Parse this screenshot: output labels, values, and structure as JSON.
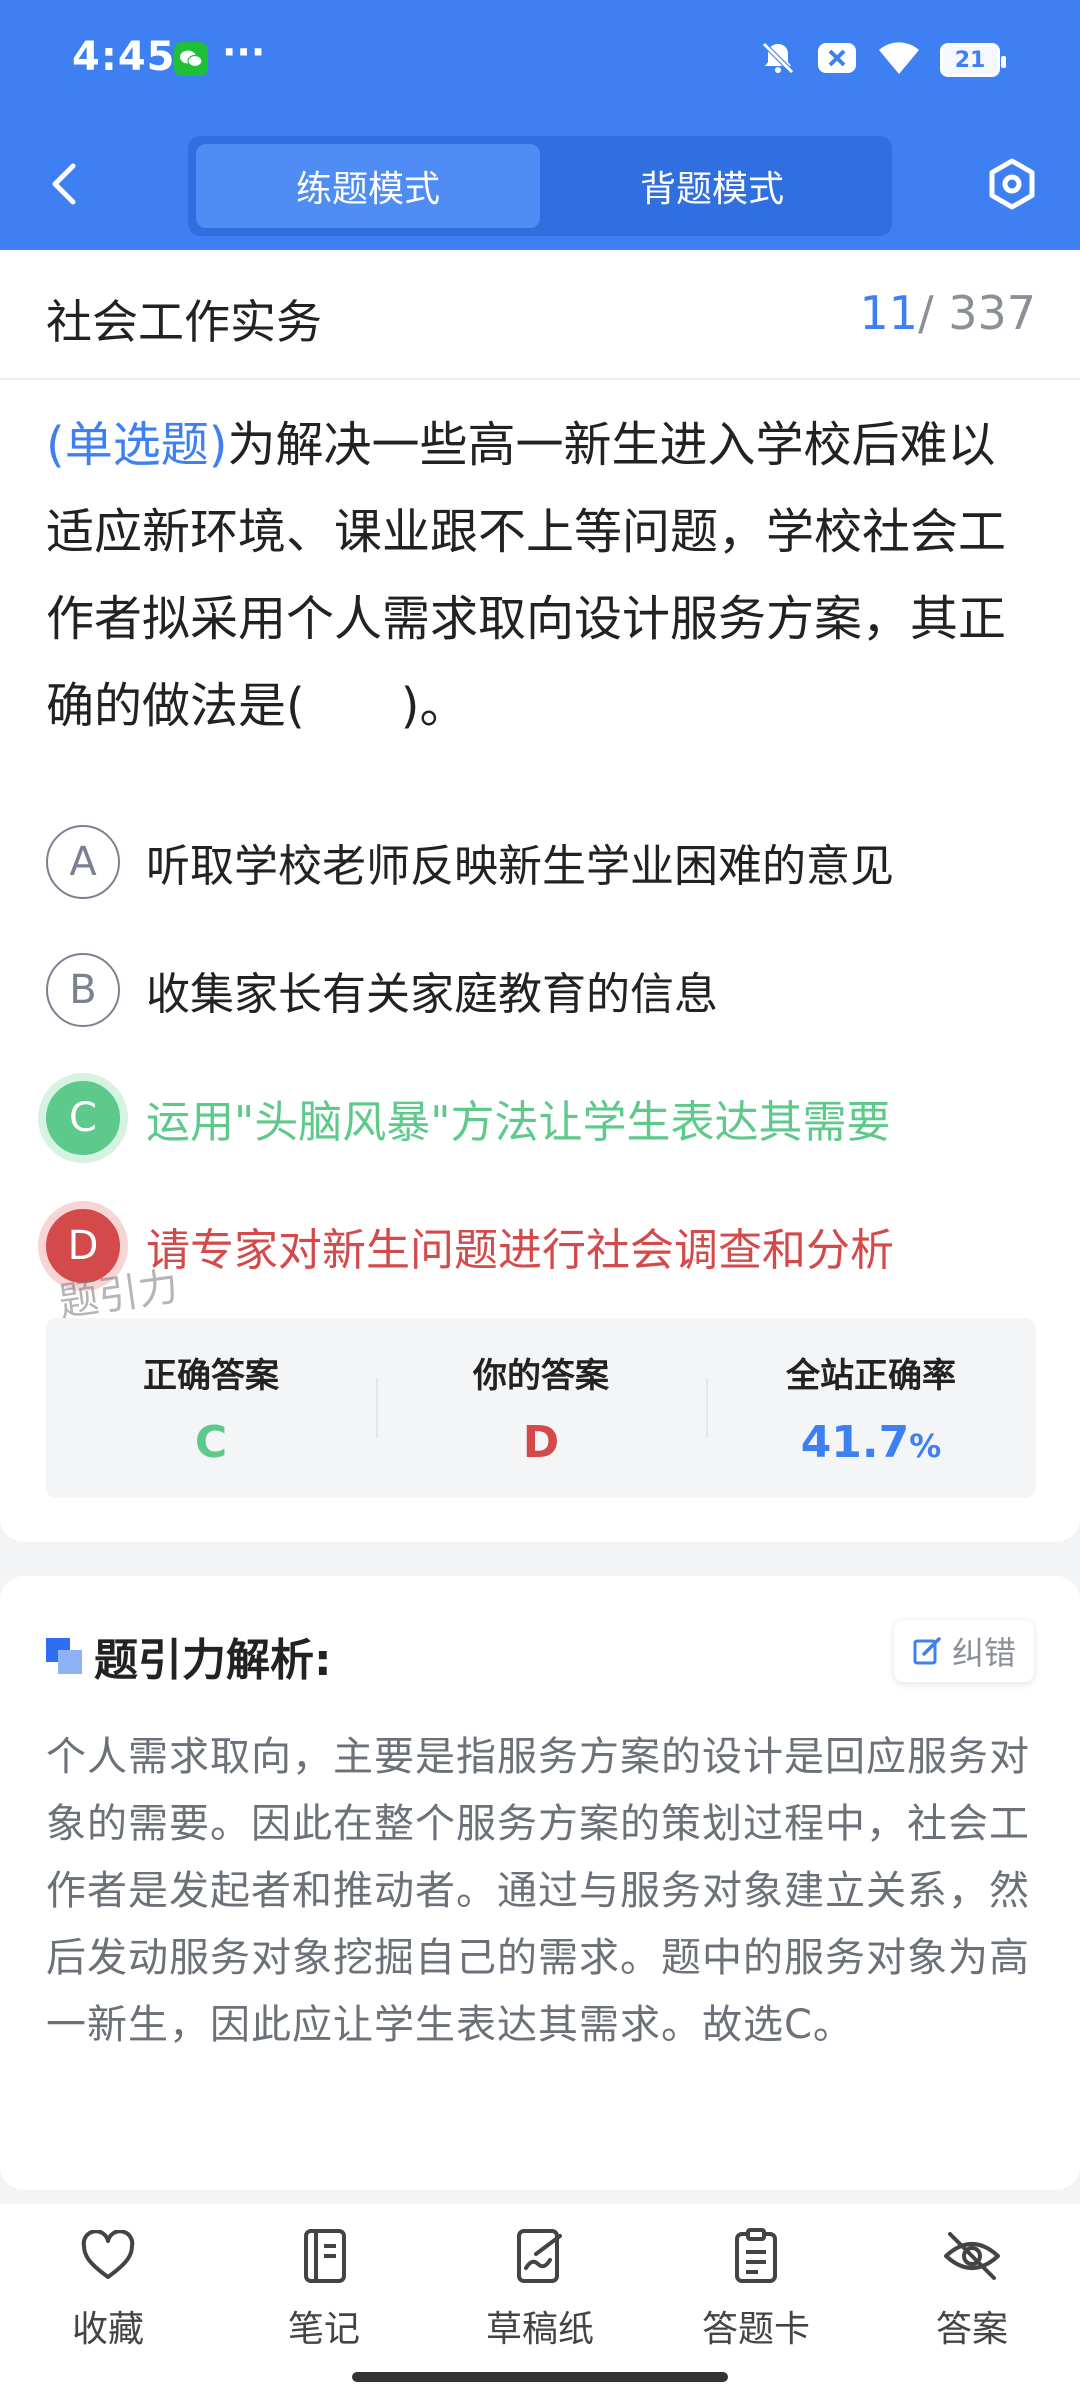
{
  "status_bar": {
    "time": "4:45",
    "more": "···",
    "battery": "21"
  },
  "header": {
    "tabs": [
      {
        "label": "练题模式",
        "active": true
      },
      {
        "label": "背题模式",
        "active": false
      }
    ]
  },
  "subject": {
    "title": "社会工作实务",
    "current": "11",
    "total": "/ 337"
  },
  "question": {
    "type": "(单选题)",
    "text": "为解决一些高一新生进入学校后难以适应新环境、课业跟不上等问题，学校社会工作者拟采用个人需求取向设计服务方案，其正确的做法是(　　)。"
  },
  "options": [
    {
      "letter": "A",
      "text": "听取学校老师反映新生学业困难的意见",
      "state": "normal"
    },
    {
      "letter": "B",
      "text": "收集家长有关家庭教育的信息",
      "state": "normal"
    },
    {
      "letter": "C",
      "text": "运用\"头脑风暴\"方法让学生表达其需要",
      "state": "correct"
    },
    {
      "letter": "D",
      "text": "请专家对新生问题进行社会调查和分析",
      "state": "wrong"
    }
  ],
  "watermark": "题引力",
  "stats": {
    "correct_label": "正确答案",
    "correct_value": "C",
    "yours_label": "你的答案",
    "yours_value": "D",
    "rate_label": "全站正确率",
    "rate_value": "41.7",
    "rate_unit": "%"
  },
  "analysis": {
    "title": "题引力解析:",
    "report_label": "纠错",
    "text": "个人需求取向，主要是指服务方案的设计是回应服务对象的需要。因此在整个服务方案的策划过程中，社会工作者是发起者和推动者。通过与服务对象建立关系，然后发动服务对象挖掘自己的需求。题中的服务对象为高一新生，因此应让学生表达其需求。故选C。"
  },
  "bottom_nav": [
    {
      "label": "收藏",
      "icon": "heart-icon"
    },
    {
      "label": "笔记",
      "icon": "notebook-icon"
    },
    {
      "label": "草稿纸",
      "icon": "draft-icon"
    },
    {
      "label": "答题卡",
      "icon": "clipboard-icon"
    },
    {
      "label": "答案",
      "icon": "eye-off-icon"
    }
  ],
  "colors": {
    "accent": "#3e7ff1",
    "correct": "#5dc98a",
    "wrong": "#d44a4a"
  }
}
